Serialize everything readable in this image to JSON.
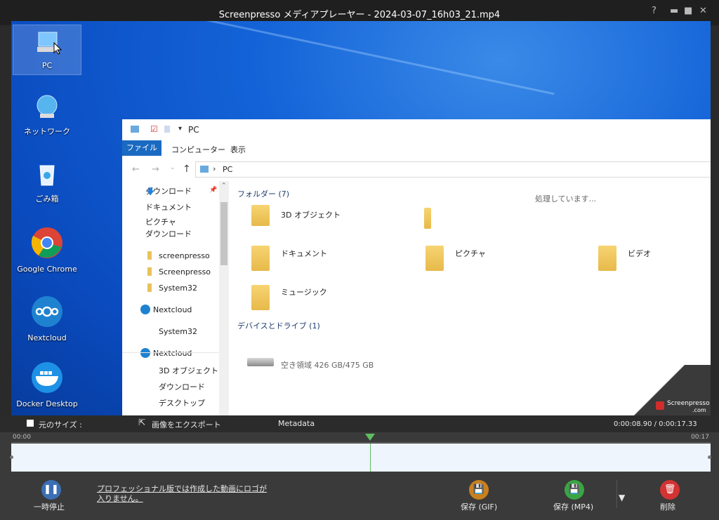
{
  "window": {
    "title": "Screenpresso メディアプレーヤー  -  2024-03-07_16h03_21.mp4",
    "help": "?",
    "minimize": "▬",
    "maximize": "■",
    "close": "✕"
  },
  "desktop": {
    "icons": [
      {
        "label": "PC"
      },
      {
        "label": "ネットワーク"
      },
      {
        "label": "ごみ箱"
      },
      {
        "label": "Google Chrome"
      },
      {
        "label": "Nextcloud"
      },
      {
        "label": "Docker Desktop"
      }
    ]
  },
  "explorer": {
    "title": "PC",
    "ribbon_tabs": [
      "ファイル",
      "コンピューター",
      "表示"
    ],
    "address": "PC",
    "nav_items": [
      "ダウンロード",
      "ドキュメント",
      "ピクチャ",
      "ダウンロード",
      "screenpresso",
      "Screenpresso",
      "System32",
      "Nextcloud",
      "System32",
      "Nextcloud",
      "3D オブジェクト",
      "ダウンロード",
      "デスクトップ"
    ],
    "section_folders": "フォルダー (7)",
    "processing": "処理しています...",
    "folders": [
      "3D オブジェクト",
      "ドキュメント",
      "ピクチャ",
      "ビデオ",
      "ミュージック"
    ],
    "section_devices": "デバイスとドライブ (1)",
    "drive_text": "空き領域 426 GB/475 GB",
    "watermark": "Screenpresso",
    "watermark_domain": ".com"
  },
  "player": {
    "original_size": "元のサイズ :",
    "export_image": "画像をエクスポート",
    "metadata": "Metadata",
    "time_display": "0:00:08.90  /  0:00:17.33",
    "start_label": "00:00",
    "end_label": "00:17",
    "progress_fraction": 0.513,
    "pause_label": "一時停止",
    "pro_notice_line1": "プロフェッショナル版では作成した動画にロゴが",
    "pro_notice_line2": "入りません。",
    "save_gif": "保存 (GIF)",
    "save_mp4": "保存 (MP4)",
    "delete": "削除",
    "colors": {
      "gif": "#c9801e",
      "mp4": "#3aa544",
      "delete": "#d33333",
      "pause": "#3b6fb5",
      "marker": "#5fbf5f"
    }
  }
}
